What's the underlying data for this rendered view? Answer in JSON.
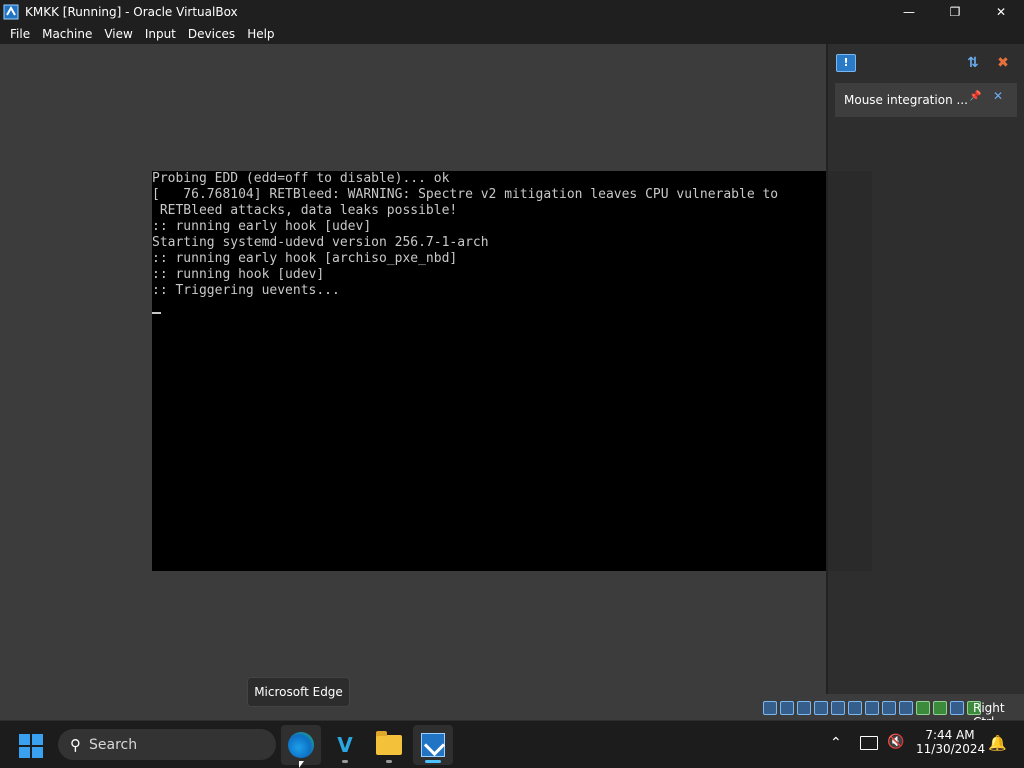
{
  "window": {
    "title": "KMKK [Running] - Oracle VirtualBox",
    "controls": {
      "minimize": "—",
      "maximize": "❐",
      "close": "✕"
    }
  },
  "menu": {
    "items": [
      {
        "label": "File"
      },
      {
        "label": "Machine"
      },
      {
        "label": "View"
      },
      {
        "label": "Input"
      },
      {
        "label": "Devices"
      },
      {
        "label": "Help"
      }
    ]
  },
  "console": {
    "lines": [
      "Probing EDD (edd=off to disable)... ok",
      "[   76.768104] RETBleed: WARNING: Spectre v2 mitigation leaves CPU vulnerable to",
      " RETBleed attacks, data leaks possible!",
      ":: running early hook [udev]",
      "Starting systemd-udevd version 256.7-1-arch",
      ":: running early hook [archiso_pxe_nbd]",
      ":: running hook [udev]",
      ":: Triggering uevents..."
    ]
  },
  "notifications": {
    "items": [
      {
        "text": "Mouse integration ..."
      }
    ]
  },
  "statusbar": {
    "host_key": "Right Ctrl"
  },
  "tooltip": {
    "text": "Microsoft Edge"
  },
  "taskbar": {
    "search_placeholder": "Search",
    "apps": [
      {
        "name": "Microsoft Edge"
      },
      {
        "name": "Visual Studio"
      },
      {
        "name": "File Explorer"
      },
      {
        "name": "Oracle VirtualBox"
      }
    ]
  },
  "clock": {
    "time": "7:44 AM",
    "date": "11/30/2024"
  },
  "colors": {
    "accent": "#4cc2ff",
    "console_bg": "#000000",
    "console_fg": "#c8c8c8"
  }
}
